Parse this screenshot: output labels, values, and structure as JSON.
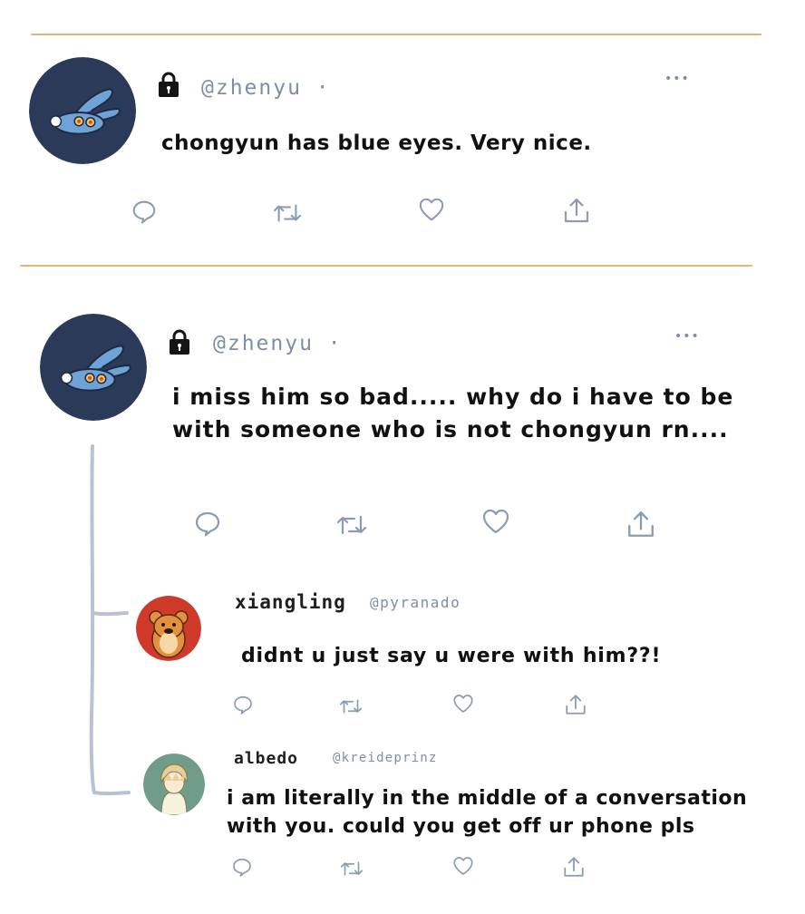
{
  "colors": {
    "divider": "#d9aa62",
    "icon": "#8a9bb3",
    "avatar_dark": "#2b3a58",
    "thread_line": "#b8c3d2"
  },
  "posts": [
    {
      "handle": "@zhenyu ·",
      "locked": true,
      "text": "chongyun has blue eyes. Very nice.",
      "more": "•••",
      "avatar": "bunny-avatar"
    },
    {
      "handle": "@zhenyu ·",
      "locked": true,
      "text_line1": "i miss him so bad..... why do i have to be",
      "text_line2": "with someone who is not chongyun rn....",
      "more": "•••",
      "avatar": "bunny-avatar"
    }
  ],
  "replies": [
    {
      "name": "xiangling",
      "handle": "@pyranado",
      "text": "didnt u just say u were with him??!",
      "avatar": "guoba-avatar"
    },
    {
      "name": "albedo",
      "handle": "@kreideprinz",
      "text_line1": "i am literally in the middle of a conversation",
      "text_line2": "with you. could you get off ur phone pls",
      "avatar": "albedo-avatar"
    }
  ],
  "actions": [
    "reply-icon",
    "retweet-icon",
    "like-icon",
    "share-icon"
  ]
}
